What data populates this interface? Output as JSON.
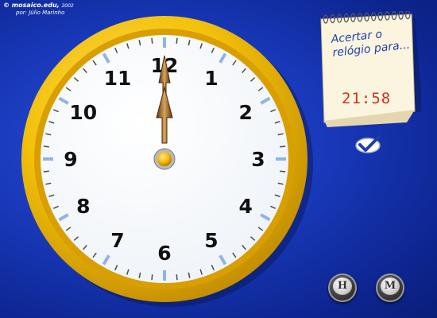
{
  "credit": {
    "site": "© mosaico.edu,",
    "year": "2002",
    "author": "por: Júlio Marinho"
  },
  "clock": {
    "numbers": [
      "12",
      "1",
      "2",
      "3",
      "4",
      "5",
      "6",
      "7",
      "8",
      "9",
      "10",
      "11"
    ],
    "hour_hand_value": 12,
    "minute_hand_value": 0
  },
  "task": {
    "prompt_line1": "Acertar o",
    "prompt_line2": "relógio para...",
    "target_time": "21:58"
  },
  "controls": {
    "hour_button_label": "H",
    "minute_button_label": "M"
  },
  "colors": {
    "background": "#1838b8",
    "rim": "#f3c10a",
    "time_digits": "#d0301c",
    "prompt_text": "#1f3fb0"
  }
}
